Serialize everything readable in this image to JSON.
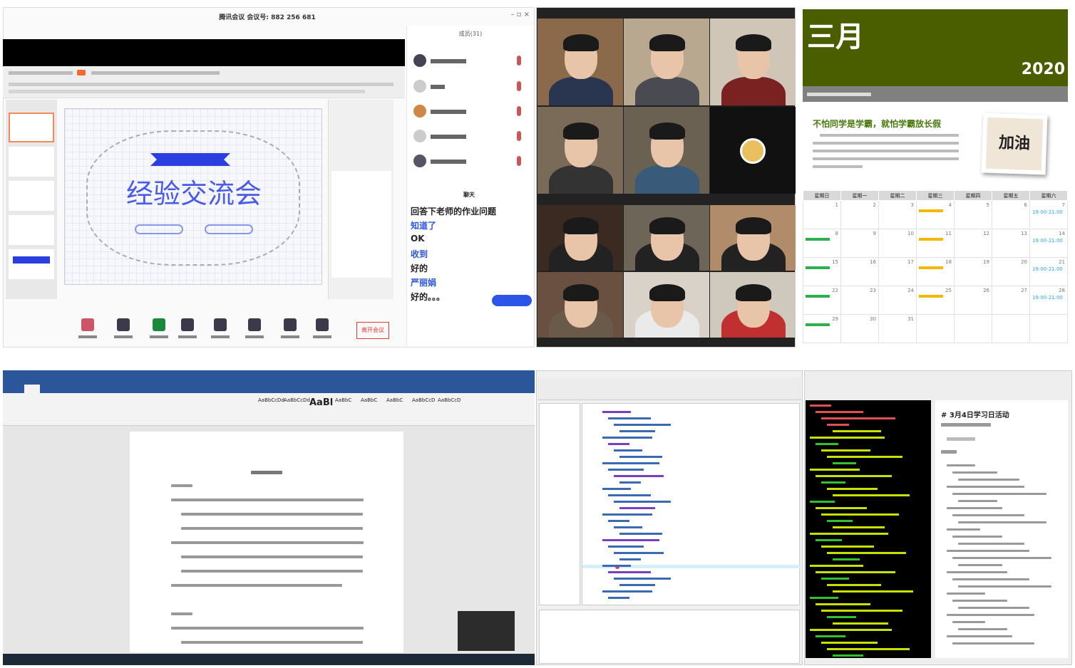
{
  "meeting": {
    "window_title": "腾讯会议 会议号: 882 256 681",
    "slide_title": "经验交流会",
    "participants_header": "成员(31)",
    "participants": [
      {
        "mic": "on"
      },
      {
        "mic": "on"
      },
      {
        "mic": "on"
      },
      {
        "mic": "on"
      },
      {
        "mic": "on"
      }
    ],
    "chat_header": "聊天",
    "chat_messages": [
      {
        "text": "回答下老师的作业问题",
        "color": "#222222"
      },
      {
        "text": "知道了",
        "color": "#2b55e6"
      },
      {
        "text": "OK",
        "color": "#222222"
      },
      {
        "text": "收到",
        "color": "#2b55e6"
      },
      {
        "text": "好的",
        "color": "#222222"
      },
      {
        "text": "严丽娟",
        "color": "#2b55e6"
      },
      {
        "text": "好的。。。",
        "color": "#222222"
      }
    ],
    "end_meeting_label": "离开会议",
    "accent_color": "#2b55e6",
    "end_color": "#e53935"
  },
  "calendar": {
    "month": "三月",
    "year": "2020",
    "headline": "不怕同学是学霸，就怕学霸放长假",
    "photo_text": "加油",
    "header_color": "#4a5e00",
    "weekdays": [
      "星期日",
      "星期一",
      "星期二",
      "星期三",
      "星期四",
      "星期五",
      "星期六"
    ],
    "weeks": [
      [
        {
          "d": "1"
        },
        {
          "d": "2"
        },
        {
          "d": "3"
        },
        {
          "d": "4",
          "ev": "orange"
        },
        {
          "d": "5"
        },
        {
          "d": "6"
        },
        {
          "d": "7",
          "ev": "blue",
          "time": "19:00-21:00"
        }
      ],
      [
        {
          "d": "8",
          "ev": "green"
        },
        {
          "d": "9"
        },
        {
          "d": "10"
        },
        {
          "d": "11",
          "ev": "orange"
        },
        {
          "d": "12"
        },
        {
          "d": "13"
        },
        {
          "d": "14",
          "ev": "blue",
          "time": "19:00-21:00"
        }
      ],
      [
        {
          "d": "15",
          "ev": "green"
        },
        {
          "d": "16"
        },
        {
          "d": "17"
        },
        {
          "d": "18",
          "ev": "orange"
        },
        {
          "d": "19"
        },
        {
          "d": "20"
        },
        {
          "d": "21",
          "ev": "blue",
          "time": "19:00-21:00"
        }
      ],
      [
        {
          "d": "22",
          "ev": "green"
        },
        {
          "d": "23"
        },
        {
          "d": "24"
        },
        {
          "d": "25",
          "ev": "orange"
        },
        {
          "d": "26"
        },
        {
          "d": "27"
        },
        {
          "d": "28",
          "ev": "blue",
          "time": "19:00-21:00"
        }
      ],
      [
        {
          "d": "29",
          "ev": "green"
        },
        {
          "d": "30"
        },
        {
          "d": "31"
        },
        {
          "d": ""
        },
        {
          "d": ""
        },
        {
          "d": ""
        },
        {
          "d": ""
        }
      ]
    ]
  },
  "word": {
    "styles": [
      "AaBbCcDd",
      "AaBbCcDd",
      "AaBl",
      "AaBbC",
      "AaBbC",
      "AaBbC",
      "AaBbCcD",
      "AaBbCcD"
    ],
    "ribbon_color": "#2b579a"
  },
  "notes": {
    "title": "# 3月4日学习日活动"
  }
}
